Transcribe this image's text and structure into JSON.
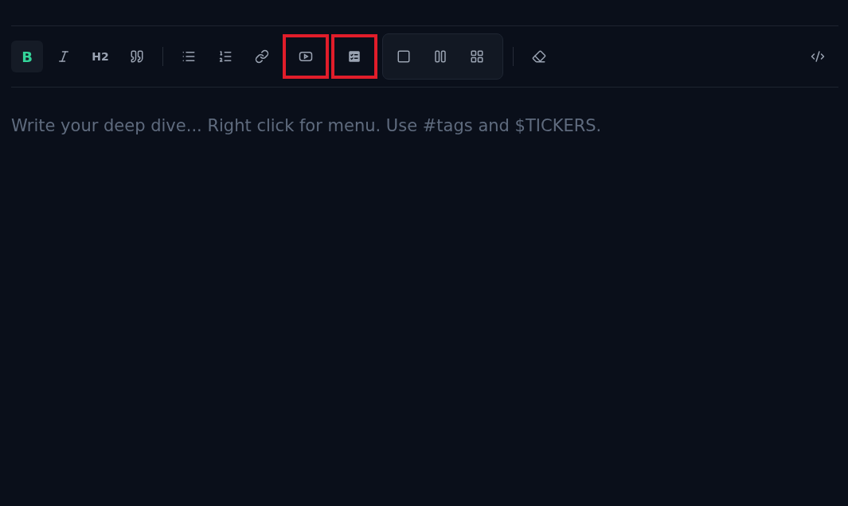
{
  "toolbar": {
    "formatting": [
      {
        "kind": "text",
        "label": "B",
        "active": true,
        "highlighted": false
      },
      {
        "kind": "italic",
        "active": false,
        "highlighted": false
      },
      {
        "kind": "text",
        "label": "H2",
        "active": false,
        "highlighted": false
      },
      {
        "kind": "quote",
        "active": false,
        "highlighted": false
      }
    ],
    "lists": [
      {
        "kind": "bullets",
        "active": false,
        "highlighted": false
      },
      {
        "kind": "numbers",
        "active": false,
        "highlighted": false
      },
      {
        "kind": "link",
        "active": false,
        "highlighted": false
      },
      {
        "kind": "video",
        "active": false,
        "highlighted": true
      },
      {
        "kind": "checklist",
        "active": false,
        "highlighted": true
      }
    ],
    "layouts": [
      {
        "kind": "single"
      },
      {
        "kind": "columns"
      },
      {
        "kind": "grid"
      }
    ],
    "tools": [
      {
        "kind": "eraser",
        "active": false,
        "highlighted": false
      }
    ],
    "end": [
      {
        "kind": "code",
        "active": false,
        "highlighted": false
      }
    ]
  },
  "editor": {
    "placeholder": "Write your deep dive... Right click for menu. Use #tags and $TICKERS."
  }
}
